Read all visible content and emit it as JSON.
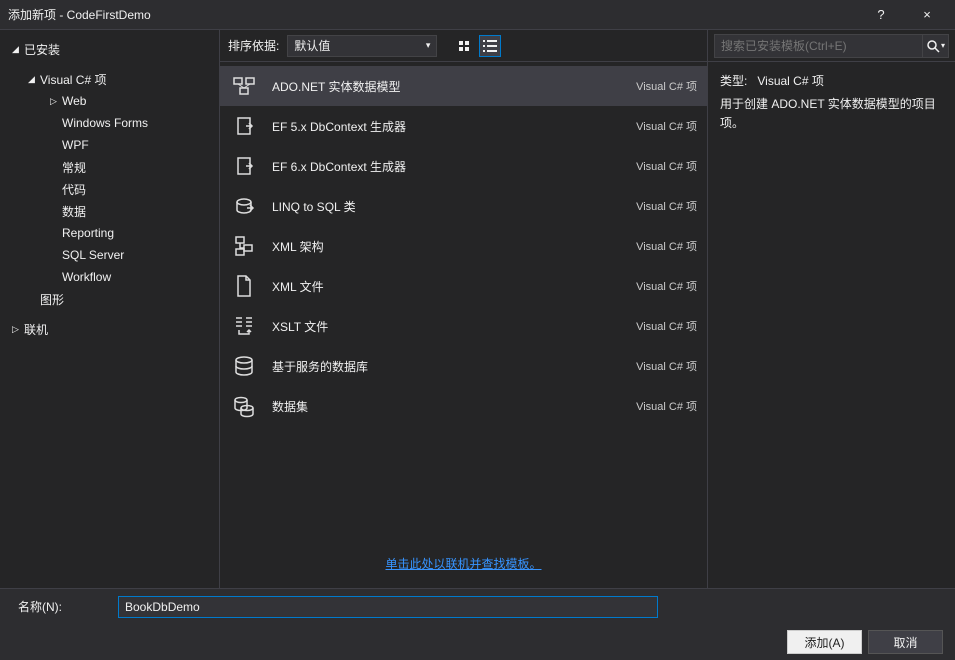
{
  "window": {
    "title": "添加新项 - CodeFirstDemo",
    "help": "?",
    "close": "×"
  },
  "sidebar": {
    "installed": "已安装",
    "vcsharp": "Visual C# 项",
    "items": [
      "Web",
      "Windows Forms",
      "WPF",
      "常规",
      "代码",
      "数据",
      "Reporting",
      "SQL Server",
      "Workflow"
    ],
    "graphics": "图形",
    "online": "联机"
  },
  "toolbar": {
    "sort_label": "排序依据:",
    "sort_value": "默认值"
  },
  "templates": [
    {
      "label": "ADO.NET 实体数据模型",
      "type": "Visual C# 项",
      "icon": "entity"
    },
    {
      "label": "EF 5.x DbContext 生成器",
      "type": "Visual C# 项",
      "icon": "gen"
    },
    {
      "label": "EF 6.x DbContext 生成器",
      "type": "Visual C# 项",
      "icon": "gen"
    },
    {
      "label": "LINQ to SQL 类",
      "type": "Visual C# 项",
      "icon": "linq"
    },
    {
      "label": "XML 架构",
      "type": "Visual C# 项",
      "icon": "xsd"
    },
    {
      "label": "XML 文件",
      "type": "Visual C# 项",
      "icon": "xml"
    },
    {
      "label": "XSLT 文件",
      "type": "Visual C# 项",
      "icon": "xslt"
    },
    {
      "label": "基于服务的数据库",
      "type": "Visual C# 项",
      "icon": "db"
    },
    {
      "label": "数据集",
      "type": "Visual C# 项",
      "icon": "dataset"
    }
  ],
  "online_link": "单击此处以联机并查找模板。",
  "search": {
    "placeholder": "搜索已安装模板(Ctrl+E)"
  },
  "detail": {
    "type_label": "类型:",
    "type_value": "Visual C# 项",
    "description": "用于创建 ADO.NET 实体数据模型的项目项。"
  },
  "footer": {
    "name_label": "名称(N):",
    "name_value": "BookDbDemo",
    "add": "添加(A)",
    "cancel": "取消"
  }
}
